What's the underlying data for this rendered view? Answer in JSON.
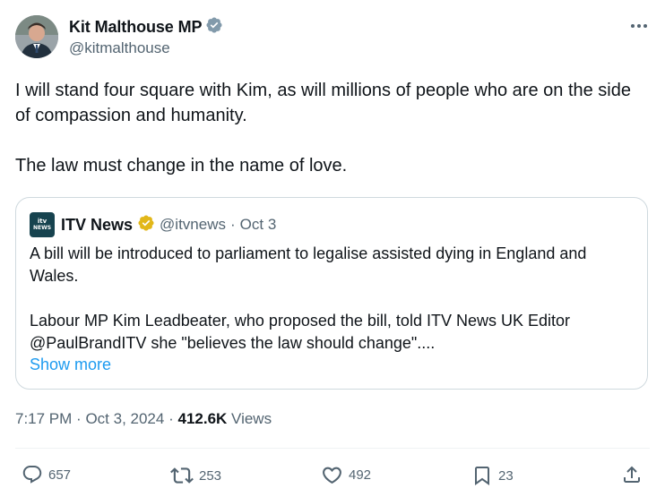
{
  "author": {
    "name": "Kit Malthouse MP",
    "handle": "@kitmalthouse",
    "verified_color": "#829aab"
  },
  "tweet": {
    "paragraphs": [
      "I will stand four square with Kim, as will millions of people who are on the side of compassion and humanity.",
      "The law must change in the name of love."
    ]
  },
  "quoted": {
    "logo_line1": "itv",
    "logo_line2": "NEWS",
    "name": "ITV News",
    "handle": "@itvnews",
    "dot": "·",
    "date": "Oct 3",
    "paragraphs": [
      "A bill will be introduced to parliament to legalise assisted dying in England and Wales.",
      "Labour MP Kim Leadbeater, who proposed the bill, told ITV News UK Editor @PaulBrandITV she \"believes the law should change\"...."
    ],
    "show_more": "Show more",
    "verified_color": "#e2b719"
  },
  "meta": {
    "time": "7:17 PM",
    "sep1": "·",
    "date": "Oct 3, 2024",
    "sep2": "·",
    "views_count": "412.6K",
    "views_label": "Views"
  },
  "actions": {
    "replies": "657",
    "reposts": "253",
    "likes": "492",
    "bookmarks": "23"
  },
  "icons": {
    "more": "more-horizontal-icon",
    "reply": "reply-icon",
    "repost": "repost-icon",
    "like": "heart-icon",
    "bookmark": "bookmark-icon",
    "share": "share-icon"
  },
  "colors": {
    "text": "#0f1419",
    "secondary": "#536471",
    "link": "#1d9bf0",
    "border": "#cfd9de"
  }
}
